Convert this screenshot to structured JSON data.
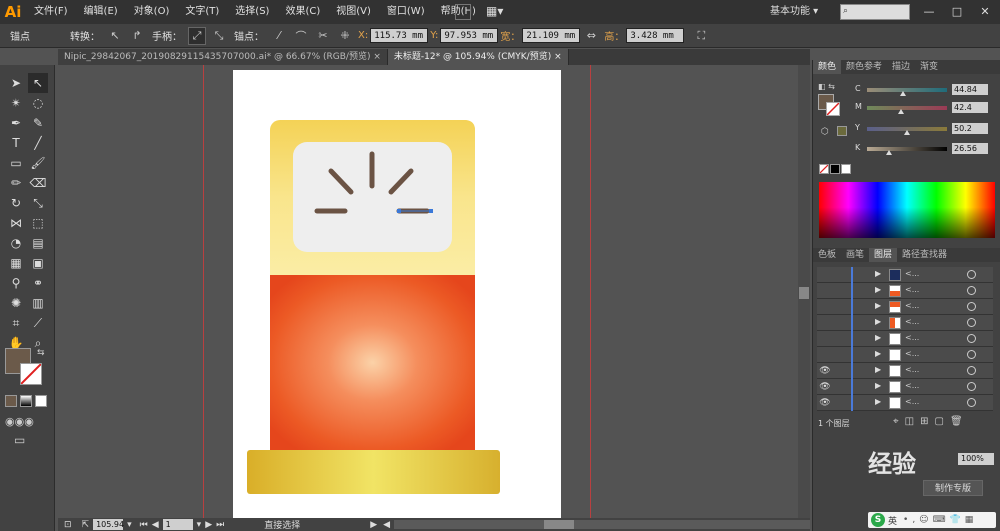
{
  "app": {
    "logo": "Ai"
  },
  "menu": [
    "文件(F)",
    "编辑(E)",
    "对象(O)",
    "文字(T)",
    "选择(S)",
    "效果(C)",
    "视图(V)",
    "窗口(W)",
    "帮助(H)"
  ],
  "workspace": "基本功能",
  "control": {
    "anchor_label": "锚点",
    "convert_label": "转换：",
    "handle_label": "手柄：",
    "anchor2_label": "锚点：",
    "x_key": "X:",
    "x_value": "115.73 mm",
    "y_key": "Y:",
    "y_value": "97.953 mm",
    "w_key": "宽：",
    "w_value": "21.109 mm",
    "h_key": "高：",
    "h_value": "3.428 mm"
  },
  "tabs": [
    {
      "label": "Nipic_29842067_20190829115435707000.ai* @ 66.67% (RGB/预览)",
      "close": "×"
    },
    {
      "label": "未标题-12* @ 105.94% (CMYK/预览)",
      "close": "×"
    }
  ],
  "status": {
    "zoom": "105.94",
    "page": "1",
    "tool": "直接选择"
  },
  "color_panel": {
    "tabs": [
      "颜色",
      "颜色参考",
      "描边",
      "渐变"
    ],
    "c_label": "C",
    "c_value": "44.84",
    "m_label": "M",
    "m_value": "42.4",
    "y_label": "Y",
    "y_value": "50.2",
    "k_label": "K",
    "k_value": "26.56",
    "c_level": 0.45,
    "m_level": 0.42,
    "y_level": 0.5,
    "k_level": 0.27
  },
  "layers_panel": {
    "tabs": [
      "色板",
      "画笔",
      "图层",
      "路径查找器"
    ],
    "rows": [
      {
        "name": "<...",
        "visible": ""
      },
      {
        "name": "<...",
        "visible": ""
      },
      {
        "name": "<...",
        "visible": ""
      },
      {
        "name": "<...",
        "visible": ""
      },
      {
        "name": "<...",
        "visible": ""
      },
      {
        "name": "<...",
        "visible": ""
      },
      {
        "name": "<...",
        "visible": "👁"
      },
      {
        "name": "<...",
        "visible": "👁"
      },
      {
        "name": "<...",
        "visible": "👁"
      }
    ],
    "footer": "1 个图层"
  },
  "extra": {
    "percent": "100%",
    "make_template": "制作专版",
    "watermark": "经验",
    "ime": "英"
  },
  "colors": {
    "fill_swatch": "#6b5a4a",
    "lamp_top": "#f7d769",
    "lamp_body": "#ee5a23",
    "lamp_base": "#e7c43a",
    "screen": "#eeeeee",
    "rays": "#6b5344"
  }
}
